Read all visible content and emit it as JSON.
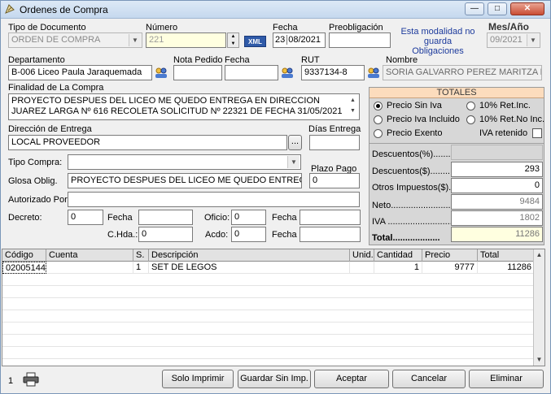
{
  "window": {
    "title": "Ordenes de Compra"
  },
  "labels": {
    "tipo_documento": "Tipo de Documento",
    "numero": "Número",
    "fecha": "Fecha",
    "preobligacion": "Preobligación",
    "modalidad_note": "Esta modalidad no guarda Obligaciones",
    "mes_ano": "Mes/Año",
    "departamento": "Departamento",
    "nota_pedido": "Nota Pedido",
    "fecha2": "Fecha",
    "rut": "RUT",
    "nombre": "Nombre",
    "finalidad": "Finalidad de La Compra",
    "direccion_entrega": "Dirección de Entrega",
    "dias_entrega": "Días Entrega",
    "tipo_compra": "Tipo Compra:",
    "plazo_pago": "Plazo Pago",
    "glosa": "Glosa Oblig.",
    "autorizado": "Autorizado Por:",
    "decreto": "Decreto:",
    "fecha3": "Fecha",
    "oficio": "Oficio:",
    "fecha4": "Fecha",
    "chda": "C.Hda.:",
    "acdo": "Acdo:",
    "fecha5": "Fecha"
  },
  "fields": {
    "tipo_documento": "ORDEN DE COMPRA",
    "numero": "221",
    "xml_button": "XML",
    "fecha_day": "23",
    "fecha_rest": "08/2021",
    "preobligacion": "",
    "mes_ano": "09/2021",
    "departamento": "B-006 Liceo Paula Jaraquemada",
    "nota_pedido": "",
    "fecha_nota": "",
    "rut": "9337134-8",
    "nombre": "SORIA GALVARRO PEREZ MARITZA LORENA",
    "finalidad": "PROYECTO DESPUES DEL LICEO ME QUEDO ENTREGA EN DIRECCION JUAREZ LARGA Nº 616 RECOLETA SOLICITUD Nº 22321 DE FECHA 31/05/2021",
    "direccion_entrega": "LOCAL PROVEEDOR",
    "dias_entrega": "",
    "tipo_compra": "",
    "plazo_pago": "0",
    "glosa": "PROYECTO DESPUES DEL LICEO ME QUEDO ENTREGA",
    "autorizado": "",
    "decreto": "0",
    "decreto_fecha": "",
    "oficio": "0",
    "oficio_fecha": "",
    "chda": "0",
    "acdo": "0",
    "acdo_fecha": ""
  },
  "totales": {
    "header": "TOTALES",
    "radio_precio_sin_iva": "Precio Sin Iva",
    "radio_ret_inc": "10% Ret.Inc.",
    "radio_precio_iva_incluido": "Precio Iva Incluido",
    "radio_ret_no_inc": "10% Ret.No Inc.",
    "radio_precio_exento": "Precio Exento",
    "iva_retenido": "IVA retenido",
    "descuentos_pct_label": "Descuentos(%).........",
    "descuentos_pct_value": "",
    "descuentos_label": "Descuentos($).........",
    "descuentos_value": "293",
    "otros_label": "Otros Impuestos($)....",
    "otros_value": "0",
    "neto_label": "Neto.............................",
    "neto_value": "9484",
    "iva_label": "IVA .............................",
    "iva_value": "1802",
    "total_label": "Total...................",
    "total_value": "11286"
  },
  "grid": {
    "headers": [
      "Código",
      "Cuenta",
      "S.",
      "Descripción",
      "Unid.",
      "Cantidad",
      "Precio",
      "Total"
    ],
    "rows": [
      [
        "02005144",
        "",
        "1",
        "SET DE LEGOS",
        "",
        "1",
        "9777",
        "11286"
      ]
    ]
  },
  "footer": {
    "count": "1",
    "solo_imprimir": "Solo Imprimir",
    "guardar_sin_imp": "Guardar Sin Imp.",
    "aceptar": "Aceptar",
    "cancelar": "Cancelar",
    "eliminar": "Eliminar"
  }
}
